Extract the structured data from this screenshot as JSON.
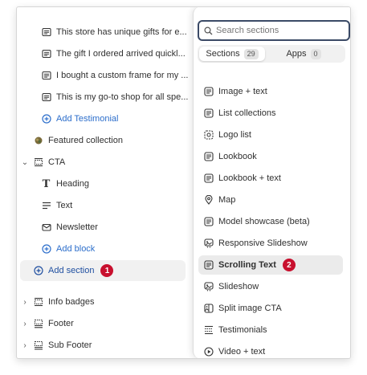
{
  "tree": {
    "testimonials": [
      "This store has unique gifts for e...",
      "The gift I ordered arrived quickl...",
      "I bought a custom frame for my ...",
      "This is my go-to shop for all spe..."
    ],
    "add_testimonial": "Add Testimonial",
    "featured_collection": "Featured collection",
    "cta": "CTA",
    "cta_children": [
      "Heading",
      "Text",
      "Newsletter"
    ],
    "add_block": "Add block",
    "add_section": "Add section",
    "add_section_badge": "1",
    "bottom_sections": [
      "Info badges",
      "Footer",
      "Sub Footer"
    ]
  },
  "picker": {
    "search_placeholder": "Search sections",
    "tabs": [
      {
        "label": "Sections",
        "count": "29"
      },
      {
        "label": "Apps",
        "count": "0"
      }
    ],
    "items": [
      {
        "label": "Image + text",
        "icon": "image-text-icon"
      },
      {
        "label": "List collections",
        "icon": "list-collections-icon"
      },
      {
        "label": "Logo list",
        "icon": "logo-list-icon"
      },
      {
        "label": "Lookbook",
        "icon": "lookbook-icon"
      },
      {
        "label": "Lookbook + text",
        "icon": "lookbook-text-icon"
      },
      {
        "label": "Map",
        "icon": "map-pin-icon"
      },
      {
        "label": "Model showcase (beta)",
        "icon": "model-showcase-icon"
      },
      {
        "label": "Responsive Slideshow",
        "icon": "slideshow-icon"
      },
      {
        "label": "Scrolling Text",
        "icon": "scrolling-text-icon"
      },
      {
        "label": "Slideshow",
        "icon": "slideshow-icon"
      },
      {
        "label": "Split image CTA",
        "icon": "split-image-icon"
      },
      {
        "label": "Testimonials",
        "icon": "testimonials-icon"
      },
      {
        "label": "Video + text",
        "icon": "video-play-icon"
      }
    ],
    "selected_badge": "2"
  },
  "colors": {
    "link": "#2c6ecb",
    "badge": "#c8102e",
    "selected_bg": "#ebebeb"
  }
}
